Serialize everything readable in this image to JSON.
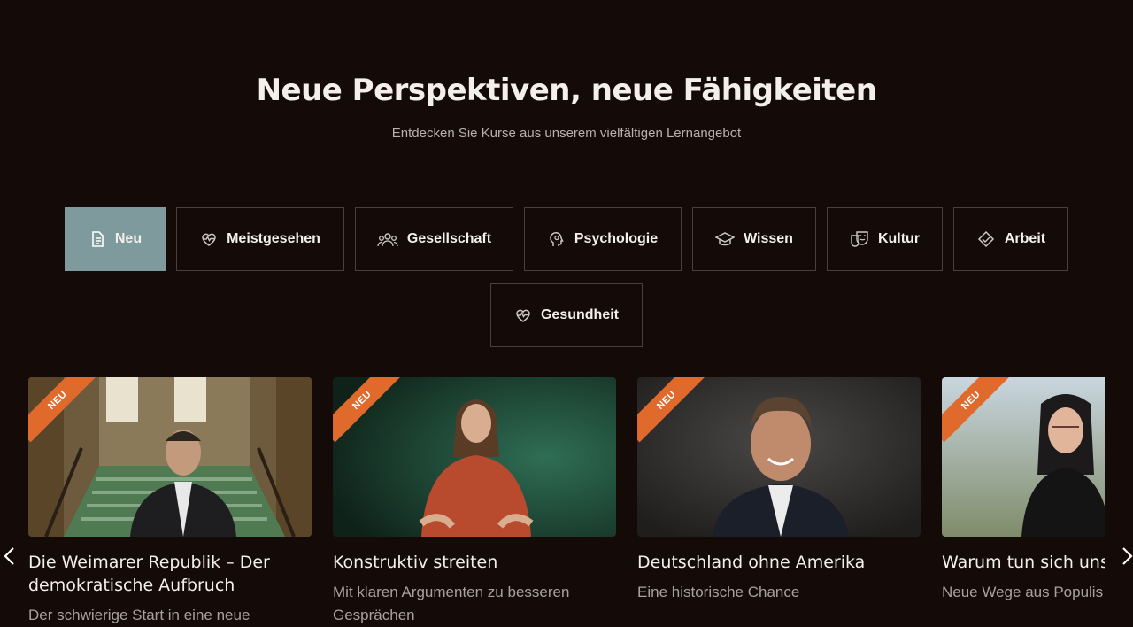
{
  "hero": {
    "title": "Neue Perspektiven, neue Fähigkeiten",
    "subtitle": "Entdecken Sie Kurse aus unserem vielfältigen Lernangebot"
  },
  "filters": [
    {
      "label": "Neu",
      "icon": "document-icon",
      "active": true
    },
    {
      "label": "Meistgesehen",
      "icon": "heart-pulse-icon",
      "active": false
    },
    {
      "label": "Gesellschaft",
      "icon": "group-icon",
      "active": false
    },
    {
      "label": "Psychologie",
      "icon": "head-brain-icon",
      "active": false
    },
    {
      "label": "Wissen",
      "icon": "graduation-cap-icon",
      "active": false
    },
    {
      "label": "Kultur",
      "icon": "theater-masks-icon",
      "active": false
    },
    {
      "label": "Arbeit",
      "icon": "handshake-icon",
      "active": false
    },
    {
      "label": "Gesundheit",
      "icon": "heart-pulse-icon",
      "active": false
    }
  ],
  "courses": [
    {
      "badge": "NEU",
      "title": "Die Weimarer Republik – Der demokratische Aufbruch",
      "subtitle": "Der schwierige Start in eine neue"
    },
    {
      "badge": "NEU",
      "title": "Konstruktiv streiten",
      "subtitle": "Mit klaren Argumenten zu besseren Gesprächen"
    },
    {
      "badge": "NEU",
      "title": "Deutschland ohne Amerika",
      "subtitle": "Eine historische Chance"
    },
    {
      "badge": "NEU",
      "title": "Warum tun sich uns mit Demokratie sch",
      "subtitle": "Neue Wege aus Populis"
    }
  ],
  "nav": {
    "prev_icon": "chevron-left-icon",
    "next_icon": "chevron-right-icon"
  },
  "colors": {
    "background": "#140a07",
    "active_filter": "#7f9a9c",
    "badge": "#e06a2c"
  }
}
